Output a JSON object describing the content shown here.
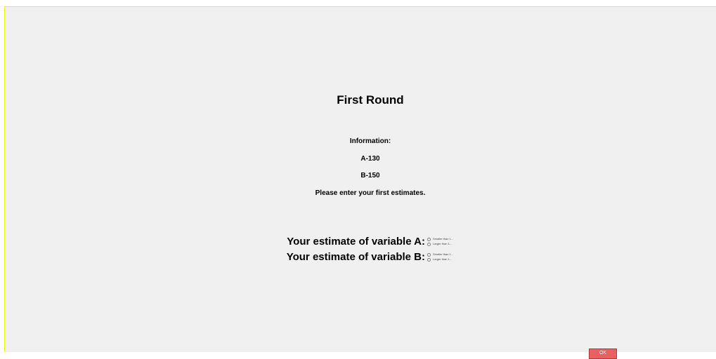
{
  "screen": {
    "title": "First Round",
    "info": {
      "heading": "Information:",
      "line_a": "A-130",
      "line_b": "B-150",
      "instruction": "Please enter your first estimates."
    }
  },
  "estimates": [
    {
      "label": "Your estimate of variable A:",
      "options": [
        "Smaller than 1…",
        "Larger than 1…"
      ]
    },
    {
      "label": "Your estimate of variable B:",
      "options": [
        "Smaller than 1…",
        "Larger than 1…"
      ]
    }
  ],
  "ok_button": {
    "label": "OK"
  },
  "colors": {
    "background": "#f0f0f0",
    "frame_border": "#f2f200",
    "button": "#e86060"
  }
}
